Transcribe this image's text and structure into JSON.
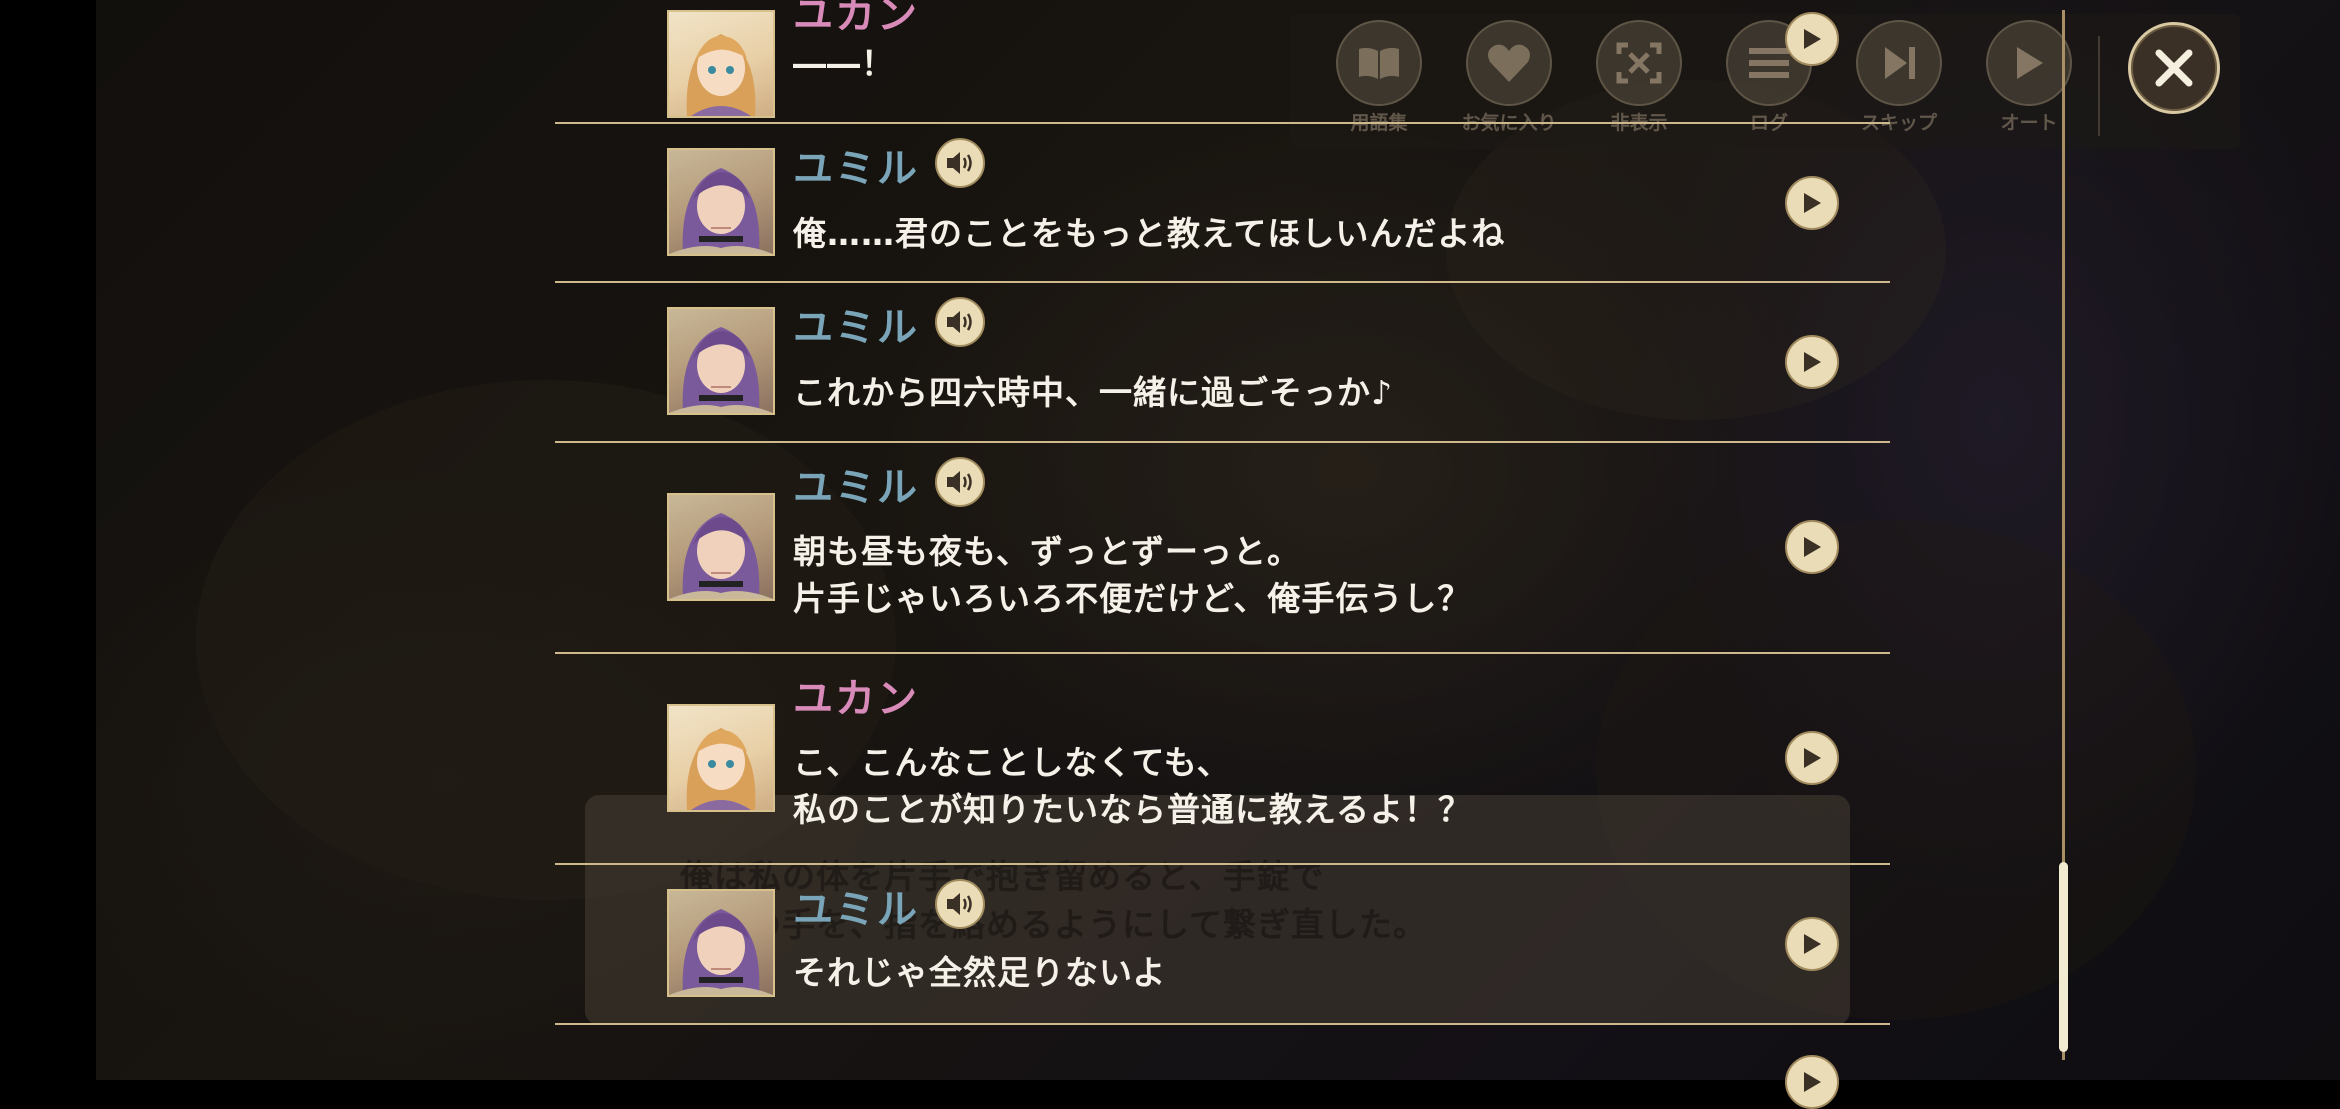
{
  "toolbar": {
    "items": [
      {
        "label": "用語集",
        "icon": "book-icon"
      },
      {
        "label": "お気に入り",
        "icon": "heart-icon"
      },
      {
        "label": "非表示",
        "icon": "hide-icon"
      },
      {
        "label": "ログ",
        "icon": "log-icon"
      },
      {
        "label": "スキップ",
        "icon": "skip-icon"
      },
      {
        "label": "オート",
        "icon": "auto-play-icon"
      }
    ]
  },
  "background_message": {
    "line1": "俺は私の体を片手で抱き留めると、手錠で",
    "line2": "た方の手を、指を絡めるようにして繋ぎ直した。"
  },
  "log": {
    "entries": [
      {
        "speaker": "ユカン",
        "text": "――！",
        "has_voice": false
      },
      {
        "speaker": "ユミル",
        "text": "俺……君のことをもっと教えてほしいんだよね",
        "has_voice": true
      },
      {
        "speaker": "ユミル",
        "text": "これから四六時中、一緒に過ごそっか♪",
        "has_voice": true
      },
      {
        "speaker": "ユミル",
        "text": "朝も昼も夜も、ずっとずーっと。\n片手じゃいろいろ不便だけど、俺手伝うし？",
        "has_voice": true
      },
      {
        "speaker": "ユカン",
        "text": "こ、こんなことしなくても、\n私のことが知りたいなら普通に教えるよ！？",
        "has_voice": false
      },
      {
        "speaker": "ユミル",
        "text": "それじゃ全然足りないよ",
        "has_voice": true
      }
    ]
  },
  "colors": {
    "yumil_name": "#7aa4b8",
    "yukan_name": "#d88ab8",
    "separator": "#cdb98c",
    "button_fill": "#e9dcb6"
  }
}
